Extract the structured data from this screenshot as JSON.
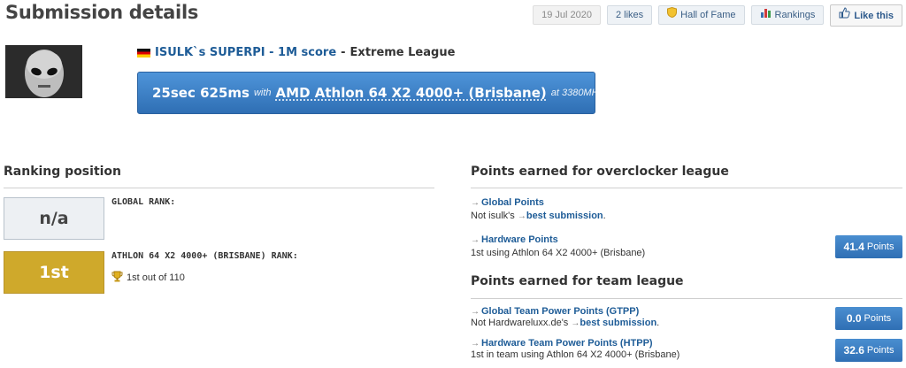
{
  "header": {
    "title": "Submission details",
    "date": "19 Jul 2020",
    "likes": "2 likes",
    "hall_of_fame": "Hall of Fame",
    "rankings": "Rankings",
    "like_this": "Like this"
  },
  "submission": {
    "user": "ISULK`s SUPERPI - 1M score",
    "separator": "-",
    "league": "Extreme League",
    "score": "25sec 625ms",
    "with": "with",
    "hardware": "AMD Athlon 64 X2 4000+ (Brisbane)",
    "frequency": "at 3380MHz"
  },
  "ranking": {
    "heading": "Ranking position",
    "global_label": "GLOBAL RANK:",
    "global_value": "n/a",
    "hw_label": "ATHLON 64 X2 4000+ (BRISBANE) RANK:",
    "hw_value": "1st",
    "hw_detail": "1st out of 110"
  },
  "overclocker_league": {
    "heading": "Points earned for overclocker league",
    "global_points_link": "Global Points",
    "global_points_desc_prefix": "Not isulk's",
    "global_points_desc_link": "best submission",
    "hardware_points_link": "Hardware Points",
    "hardware_points_desc": "1st using Athlon 64 X2 4000+ (Brisbane)",
    "hardware_points_value": "41.4",
    "points_unit": "Points"
  },
  "team_league": {
    "heading": "Points earned for team league",
    "gtpp_link": "Global Team Power Points (GTPP)",
    "gtpp_desc_prefix": "Not Hardwareluxx.de's",
    "gtpp_desc_link": "best submission",
    "gtpp_value": "0.0",
    "htpp_link": "Hardware Team Power Points (HTPP)",
    "htpp_desc": "1st in team using Athlon 64 X2 4000+ (Brisbane)",
    "htpp_value": "32.6",
    "points_unit": "Points"
  },
  "icons": {
    "hall_of_fame": "shield-icon",
    "rankings": "bar-chart-icon",
    "like": "thumbs-up-icon",
    "flag": "germany-flag-icon",
    "trophy": "trophy-icon",
    "arrow": "arrow-right-icon"
  },
  "colors": {
    "accent_blue": "#2f6fb4",
    "gold_rank": "#cfa92b",
    "link": "#1e5c97"
  }
}
